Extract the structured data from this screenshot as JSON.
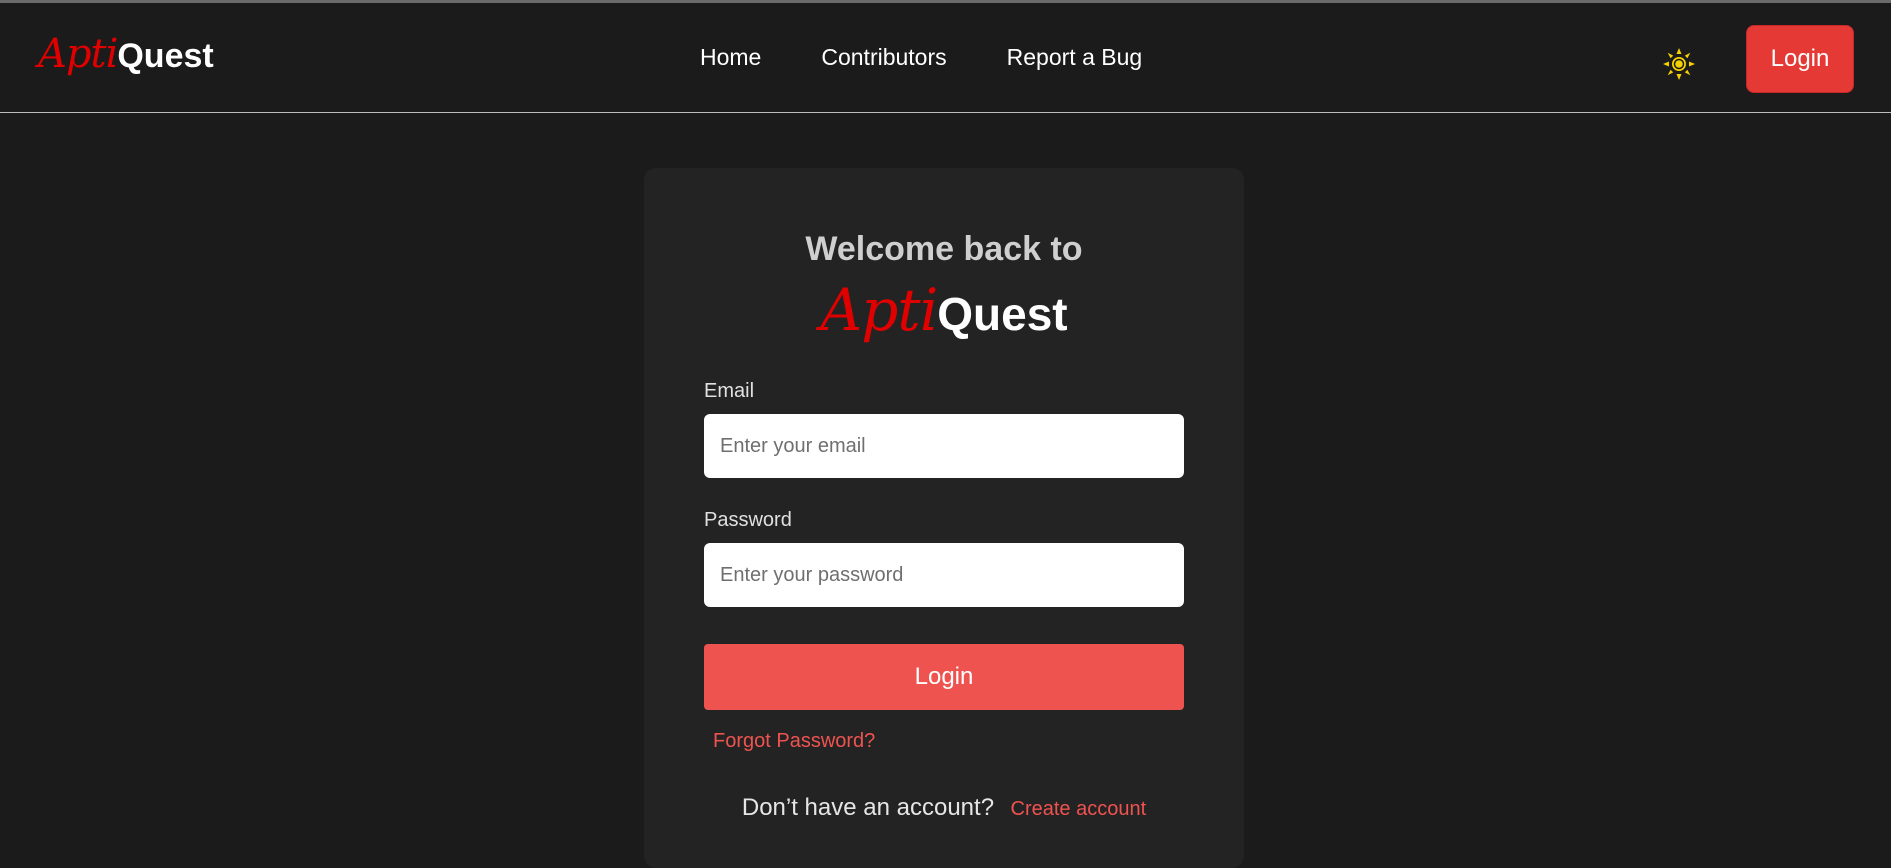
{
  "brand": {
    "part1": "Apti",
    "part2": "Quest"
  },
  "nav": {
    "links": [
      {
        "label": "Home"
      },
      {
        "label": "Contributors"
      },
      {
        "label": "Report a Bug"
      }
    ],
    "theme_icon": "sun-icon",
    "login_label": "Login"
  },
  "card": {
    "welcome": "Welcome back to",
    "brand_part1": "Apti",
    "brand_part2": "Quest",
    "email_label": "Email",
    "email_placeholder": "Enter your email",
    "email_value": "",
    "password_label": "Password",
    "password_placeholder": "Enter your password",
    "password_value": "",
    "submit_label": "Login",
    "forgot_label": "Forgot Password?",
    "no_account_text": "Don’t have an account?",
    "create_account_label": "Create account"
  },
  "colors": {
    "accent": "#ef5350",
    "brand_red": "#e00000",
    "background": "#1b1b1b",
    "card": "#232323",
    "sun": "#f5d000"
  }
}
